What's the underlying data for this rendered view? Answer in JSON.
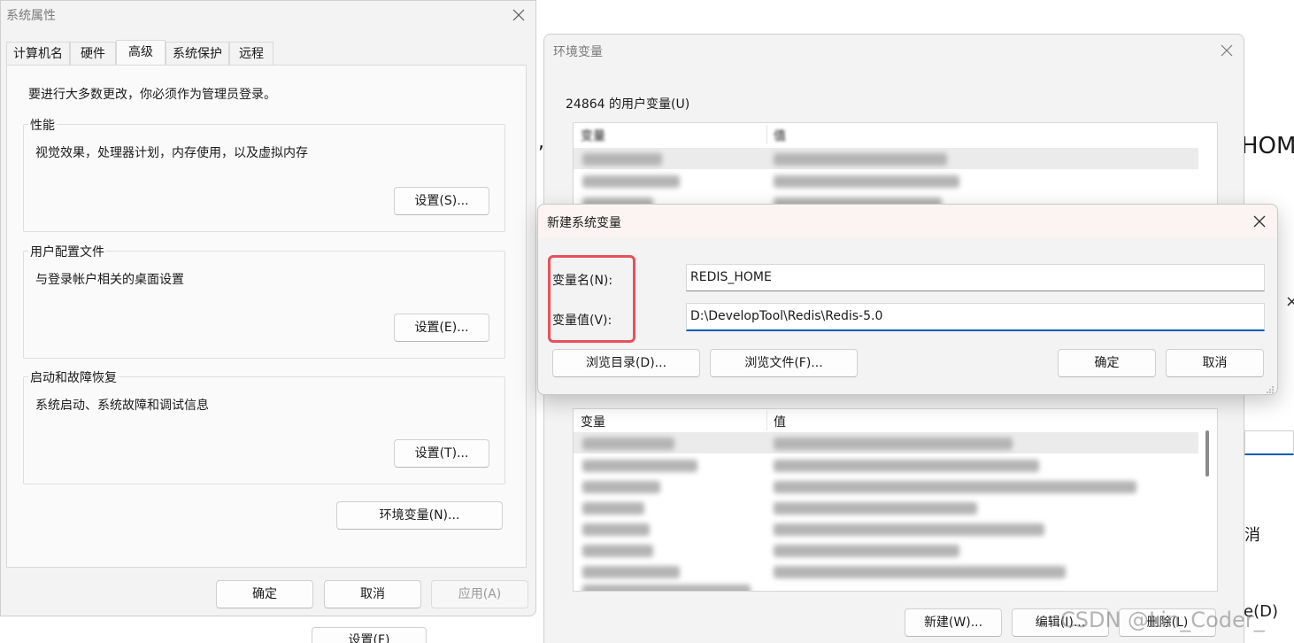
{
  "sysprops": {
    "title": "系统属性",
    "tabs": [
      {
        "label": "计算机名"
      },
      {
        "label": "硬件"
      },
      {
        "label": "高级"
      },
      {
        "label": "系统保护"
      },
      {
        "label": "远程"
      }
    ],
    "notice": "要进行大多数更改，你必须作为管理员登录。",
    "performance": {
      "label": "性能",
      "text": "视觉效果，处理器计划，内存使用，以及虚拟内存",
      "button": "设置(S)..."
    },
    "profile": {
      "label": "用户配置文件",
      "text": "与登录帐户相关的桌面设置",
      "button": "设置(E)..."
    },
    "startup": {
      "label": "启动和故障恢复",
      "text": "系统启动、系统故障和调试信息",
      "button": "设置(T)..."
    },
    "env_button": "环境变量(N)...",
    "ok": "确定",
    "cancel": "取消",
    "apply": "应用(A)"
  },
  "envvars": {
    "title": "环境变量",
    "user_group_label": "24864 的用户变量(U)",
    "col_name": "变量",
    "col_value": "值",
    "new_button": "新建(W)...",
    "edit_button": "编辑(I)...",
    "delete_button": "删除(L)"
  },
  "newvar": {
    "title": "新建系统变量",
    "name_label": "变量名(N):",
    "value_label": "变量值(V):",
    "name_value": "REDIS_HOME",
    "value_value": "D:\\DevelopTool\\Redis\\Redis-5.0",
    "browse_dir": "浏览目录(D)...",
    "browse_file": "浏览文件(F)...",
    "ok": "确定",
    "cancel": "取消",
    "highlight_color": "#e8505b"
  },
  "background": {
    "right_text": "HOM",
    "right_btn1": "消",
    "right_btn2": "e(D)",
    "behind_btn": "设置(F)"
  },
  "watermark": "CSDN @Lin_Coder_"
}
